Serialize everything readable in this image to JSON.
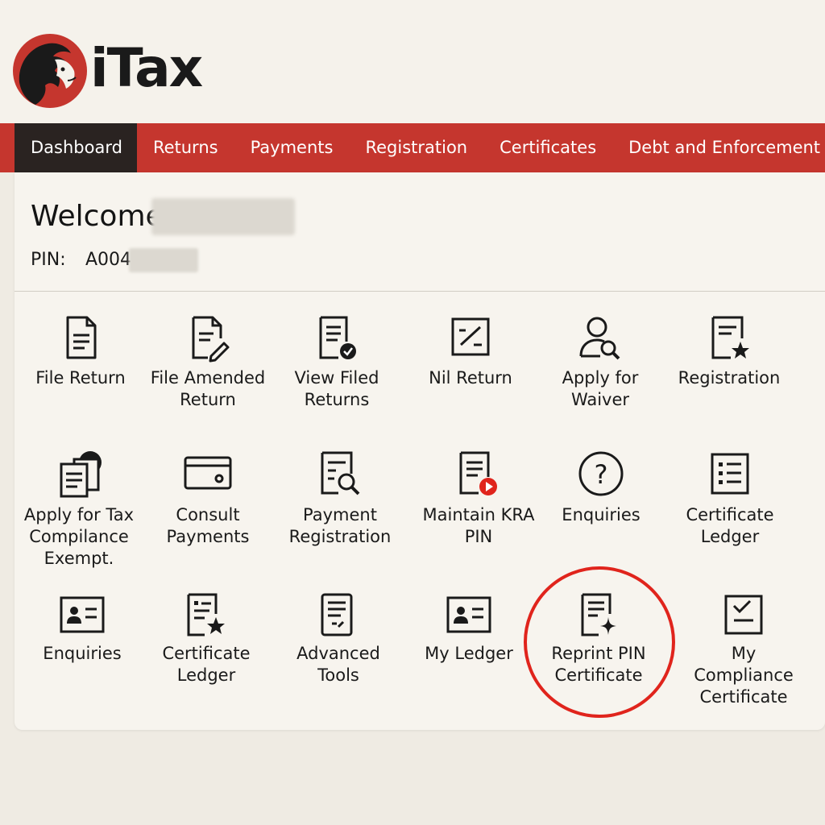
{
  "brand": {
    "name": "iTax",
    "accent": "#c5362e",
    "dark": "#2a2321"
  },
  "nav": {
    "items": [
      {
        "label": "Dashboard",
        "active": true
      },
      {
        "label": "Returns",
        "active": false
      },
      {
        "label": "Payments",
        "active": false
      },
      {
        "label": "Registration",
        "active": false
      },
      {
        "label": "Certificates",
        "active": false
      },
      {
        "label": "Debt and Enforcement",
        "active": false
      }
    ]
  },
  "welcome": {
    "label": "Welcome"
  },
  "pin": {
    "label": "PIN:",
    "value": "A004"
  },
  "tiles": [
    {
      "label": "File Return",
      "icon": "document-icon"
    },
    {
      "label": "File Amended Return",
      "icon": "document-edit-icon"
    },
    {
      "label": "View Filed Returns",
      "icon": "document-check-icon"
    },
    {
      "label": "Nil Return",
      "icon": "percent-box-icon"
    },
    {
      "label": "Apply for Waiver",
      "icon": "user-search-icon"
    },
    {
      "label": "Registration",
      "icon": "document-star-icon"
    },
    {
      "label": "Apply for Tax Compilance Exempt.",
      "icon": "documents-stack-icon"
    },
    {
      "label": "Consult Payments",
      "icon": "card-icon"
    },
    {
      "label": "Payment Registration",
      "icon": "document-search-icon"
    },
    {
      "label": "Maintain KRA PIN",
      "icon": "document-play-icon"
    },
    {
      "label": "Enquiries",
      "icon": "question-circle-icon"
    },
    {
      "label": "Certificate Ledger",
      "icon": "list-box-icon"
    },
    {
      "label": "Enquiries",
      "icon": "id-card-icon"
    },
    {
      "label": "Certificate Ledger",
      "icon": "document-star-icon"
    },
    {
      "label": "Advanced Tools",
      "icon": "document-tools-icon"
    },
    {
      "label": "My Ledger",
      "icon": "id-card-icon"
    },
    {
      "label": "Reprint PIN Certificate",
      "icon": "document-sparkle-icon"
    },
    {
      "label": "My Compliance Certificate",
      "icon": "check-box-icon"
    }
  ],
  "highlight_color": "#e0241c"
}
